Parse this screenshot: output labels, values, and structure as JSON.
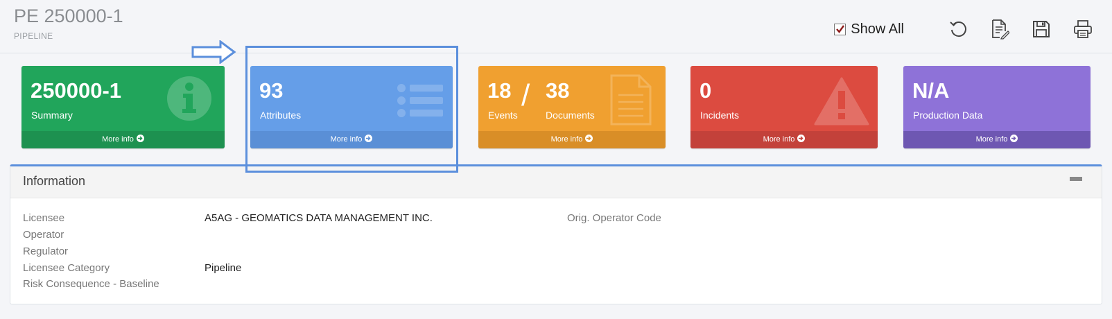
{
  "header": {
    "title": "PE 250000-1",
    "subtitle": "PIPELINE"
  },
  "toolbar": {
    "show_all_label": "Show All",
    "show_all_checked": true,
    "buttons": [
      "refresh-icon",
      "edit-document-icon",
      "save-icon",
      "print-icon"
    ]
  },
  "cards": {
    "summary": {
      "value": "250000-1",
      "label": "Summary",
      "more": "More info",
      "icon": "info-icon",
      "color": "#21a55b"
    },
    "attributes": {
      "value": "93",
      "label": "Attributes",
      "more": "More info",
      "icon": "list-icon",
      "color": "#659ee8"
    },
    "events_docs": {
      "value1": "18",
      "label1": "Events",
      "sep": "/",
      "value2": "38",
      "label2": "Documents",
      "more": "More info",
      "icon": "document-icon",
      "color": "#f0a030"
    },
    "incidents": {
      "value": "0",
      "label": "Incidents",
      "more": "More info",
      "icon": "warning-icon",
      "color": "#dc4b40"
    },
    "production": {
      "value": "N/A",
      "label": "Production Data",
      "more": "More info",
      "color": "#8e72d8"
    }
  },
  "information": {
    "title": "Information",
    "fields": [
      {
        "label": "Licensee",
        "value": "A5AG - GEOMATICS DATA MANAGEMENT INC."
      },
      {
        "label": "Operator",
        "value": ""
      },
      {
        "label": "Regulator",
        "value": ""
      },
      {
        "label": "Licensee Category",
        "value": "Pipeline"
      },
      {
        "label": "Risk Consequence - Baseline",
        "value": ""
      }
    ],
    "right_fields": [
      {
        "label": "Orig. Operator Code",
        "value": ""
      }
    ]
  }
}
